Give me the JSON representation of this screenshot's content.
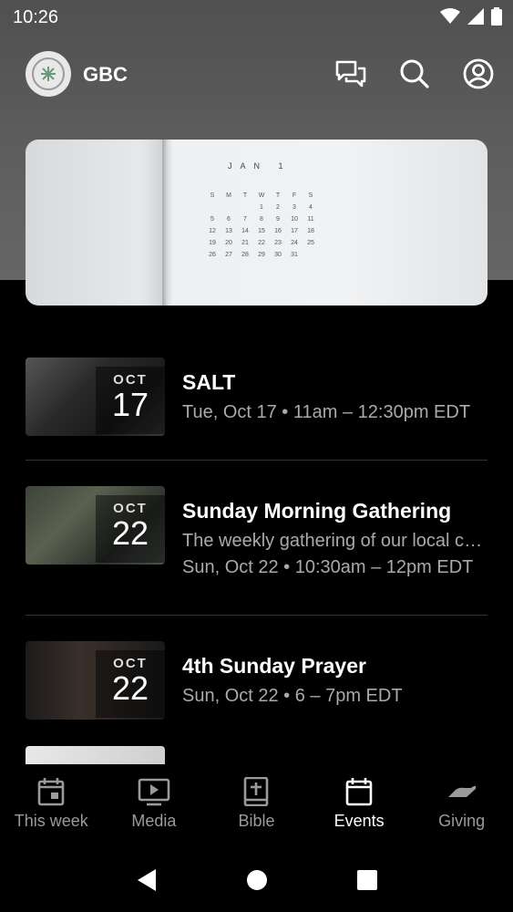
{
  "status_bar": {
    "time": "10:26"
  },
  "app_bar": {
    "title": "GBC"
  },
  "hero": {
    "month": "JAN 1",
    "weekdays": [
      "S",
      "M",
      "T",
      "W",
      "T",
      "F",
      "S"
    ],
    "days": [
      "",
      "",
      "",
      "1",
      "2",
      "3",
      "4",
      "5",
      "6",
      "7",
      "8",
      "9",
      "10",
      "11",
      "12",
      "13",
      "14",
      "15",
      "16",
      "17",
      "18",
      "19",
      "20",
      "21",
      "22",
      "23",
      "24",
      "25",
      "26",
      "27",
      "28",
      "29",
      "30",
      "31",
      ""
    ]
  },
  "events": [
    {
      "month": "OCT",
      "day": "17",
      "title": "SALT",
      "lines": [
        "Tue, Oct 17 • 11am – 12:30pm EDT"
      ]
    },
    {
      "month": "OCT",
      "day": "22",
      "title": "Sunday Morning Gathering",
      "lines": [
        "The weekly gathering of our local church",
        "Sun, Oct 22 • 10:30am – 12pm EDT"
      ]
    },
    {
      "month": "OCT",
      "day": "22",
      "title": "4th Sunday Prayer",
      "lines": [
        "Sun, Oct 22 • 6 – 7pm EDT"
      ]
    }
  ],
  "bottom_nav": [
    {
      "label": "This week",
      "icon": "calendar-day-icon",
      "active": false
    },
    {
      "label": "Media",
      "icon": "play-screen-icon",
      "active": false
    },
    {
      "label": "Bible",
      "icon": "bible-icon",
      "active": false
    },
    {
      "label": "Events",
      "icon": "calendar-icon",
      "active": true
    },
    {
      "label": "Giving",
      "icon": "giving-hand-icon",
      "active": false
    }
  ],
  "colors": {
    "background": "#000000",
    "header": "#5a5a5a",
    "muted_text": "#aaaaaa",
    "divider": "#333333"
  }
}
